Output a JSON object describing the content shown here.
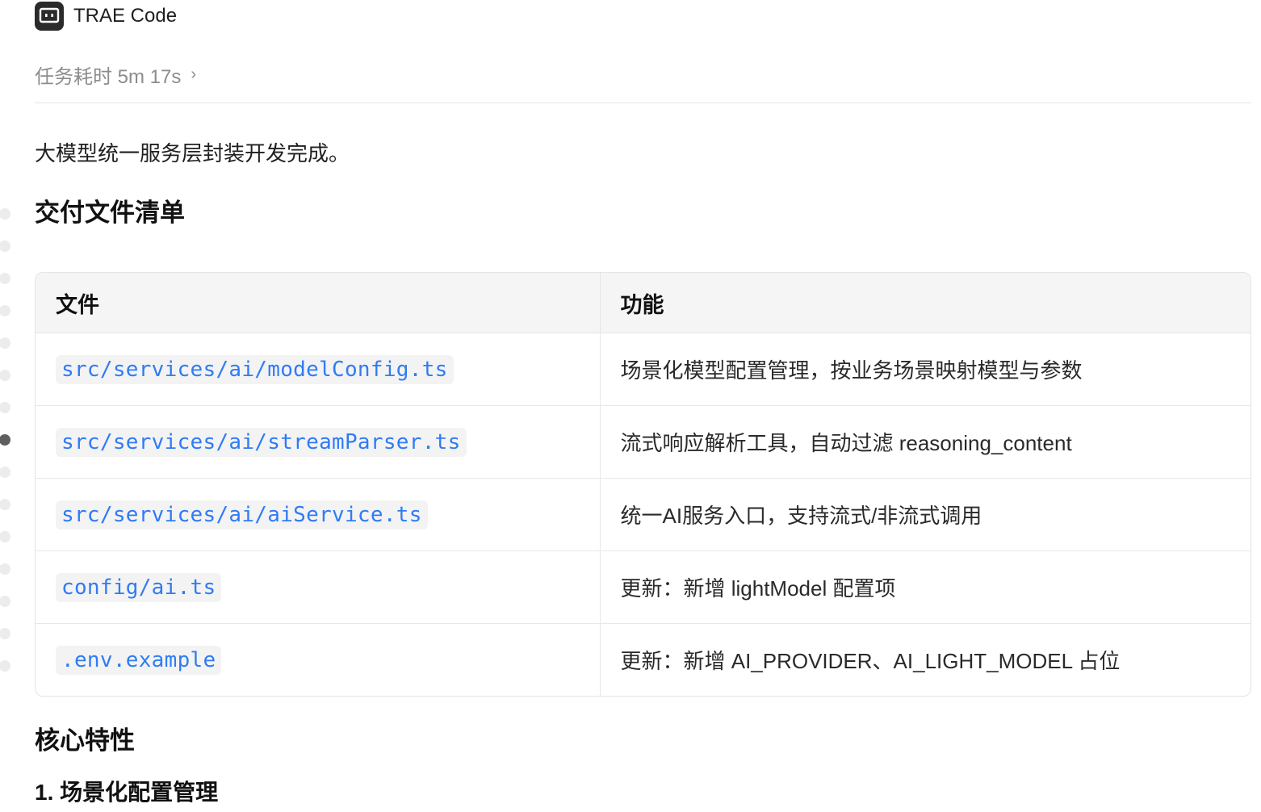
{
  "header": {
    "app_name": "TRAE Code",
    "logo_icon": "terminal-chat-icon"
  },
  "task": {
    "time_label": "任务耗时 5m 17s",
    "chevron": "›"
  },
  "intro": "大模型统一服务层封装开发完成。",
  "section_files": {
    "title": "交付文件清单",
    "columns": [
      "文件",
      "功能"
    ],
    "rows": [
      {
        "file": "src/services/ai/modelConfig.ts",
        "desc": "场景化模型配置管理，按业务场景映射模型与参数"
      },
      {
        "file": "src/services/ai/streamParser.ts",
        "desc": "流式响应解析工具，自动过滤 reasoning_content"
      },
      {
        "file": "src/services/ai/aiService.ts",
        "desc": "统一AI服务入口，支持流式/非流式调用"
      },
      {
        "file": "config/ai.ts",
        "desc": "更新：新增 lightModel 配置项"
      },
      {
        "file": ".env.example",
        "desc": "更新：新增 AI_PROVIDER、AI_LIGHT_MODEL 占位"
      }
    ]
  },
  "section_features": {
    "title": "核心特性",
    "subtitle": "1. 场景化配置管理"
  },
  "colors": {
    "code_text": "#2f7bf5",
    "code_bg": "#f3f3f3",
    "muted": "#8c8c8c",
    "timeline_active": "#5f5f5f"
  }
}
